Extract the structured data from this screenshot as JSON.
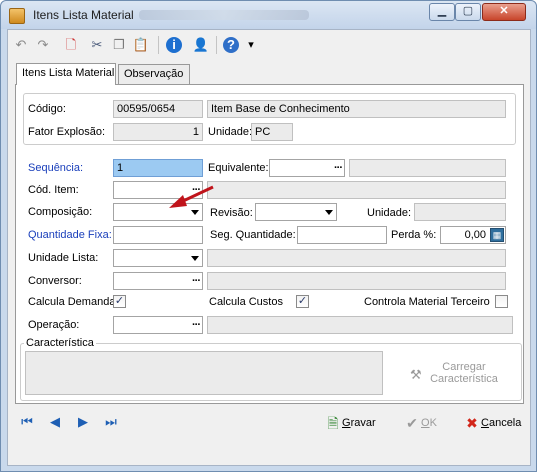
{
  "window": {
    "title": "Itens Lista Material",
    "min_glyph": "▁",
    "max_glyph": "▢",
    "close_glyph": "✕"
  },
  "toolbar": {
    "icons": [
      "undo-icon",
      "redo-icon",
      "new-document-icon",
      "cut-icon",
      "copy-icon",
      "paste-icon",
      "info-icon",
      "user-icon",
      "help-icon",
      "chevron-down-icon"
    ],
    "glyphs": {
      "undo": "↶",
      "redo": "↷",
      "new": "🗋",
      "cut": "✂",
      "copy": "❐",
      "paste": "📋",
      "info": "i",
      "user": "👤",
      "help": "?",
      "more": "▾"
    }
  },
  "tabs": [
    {
      "label": "Itens Lista Material",
      "active": true
    },
    {
      "label": "Observação",
      "active": false
    }
  ],
  "header": {
    "codigo_label": "Código:",
    "codigo_value": "00595/0654",
    "codigo_desc": "Item Base de Conhecimento",
    "fator_label": "Fator Explosão:",
    "fator_value": "1",
    "unidade_label": "Unidade:",
    "unidade_value": "PC"
  },
  "form": {
    "sequencia_label": "Sequência:",
    "sequencia_value": "1",
    "equivalente_label": "Equivalente:",
    "cod_item_label": "Cód. Item:",
    "composicao_label": "Composição:",
    "revisao_label": "Revisão:",
    "unidade_label": "Unidade:",
    "qtd_fixa_label": "Quantidade Fixa:",
    "seg_qtd_label": "Seg. Quantidade:",
    "perda_label": "Perda %:",
    "perda_value": "0,00",
    "unidade_lista_label": "Unidade Lista:",
    "conversor_label": "Conversor:",
    "calcula_demanda_label": "Calcula Demanda",
    "calcula_demanda_checked": true,
    "calcula_custos_label": "Calcula Custos",
    "calcula_custos_checked": true,
    "controla_material_label": "Controla Material Terceiro",
    "controla_material_checked": false,
    "operacao_label": "Operação:",
    "ellipsis": "···",
    "check_glyph": "✓"
  },
  "caracteristica": {
    "group_label": "Característica",
    "button_line1": "Carregar",
    "button_line2": "Característica"
  },
  "bottom": {
    "nav_glyphs": {
      "first": "⏮",
      "prev": "◀",
      "next": "▶",
      "last": "⏭"
    },
    "gravar_label": "Gravar",
    "gravar_underline": "G",
    "gravar_rest": "ravar",
    "ok_underline": "O",
    "ok_rest": "K",
    "cancela_underline": "C",
    "cancela_rest": "ancela",
    "gravar_glyph": "🗎",
    "ok_glyph": "✔",
    "cancela_glyph": "✖"
  },
  "colors": {
    "accent_blue": "#1a3fbb",
    "focus_field": "#9ccaf2",
    "annotation_arrow": "#c0141b"
  }
}
